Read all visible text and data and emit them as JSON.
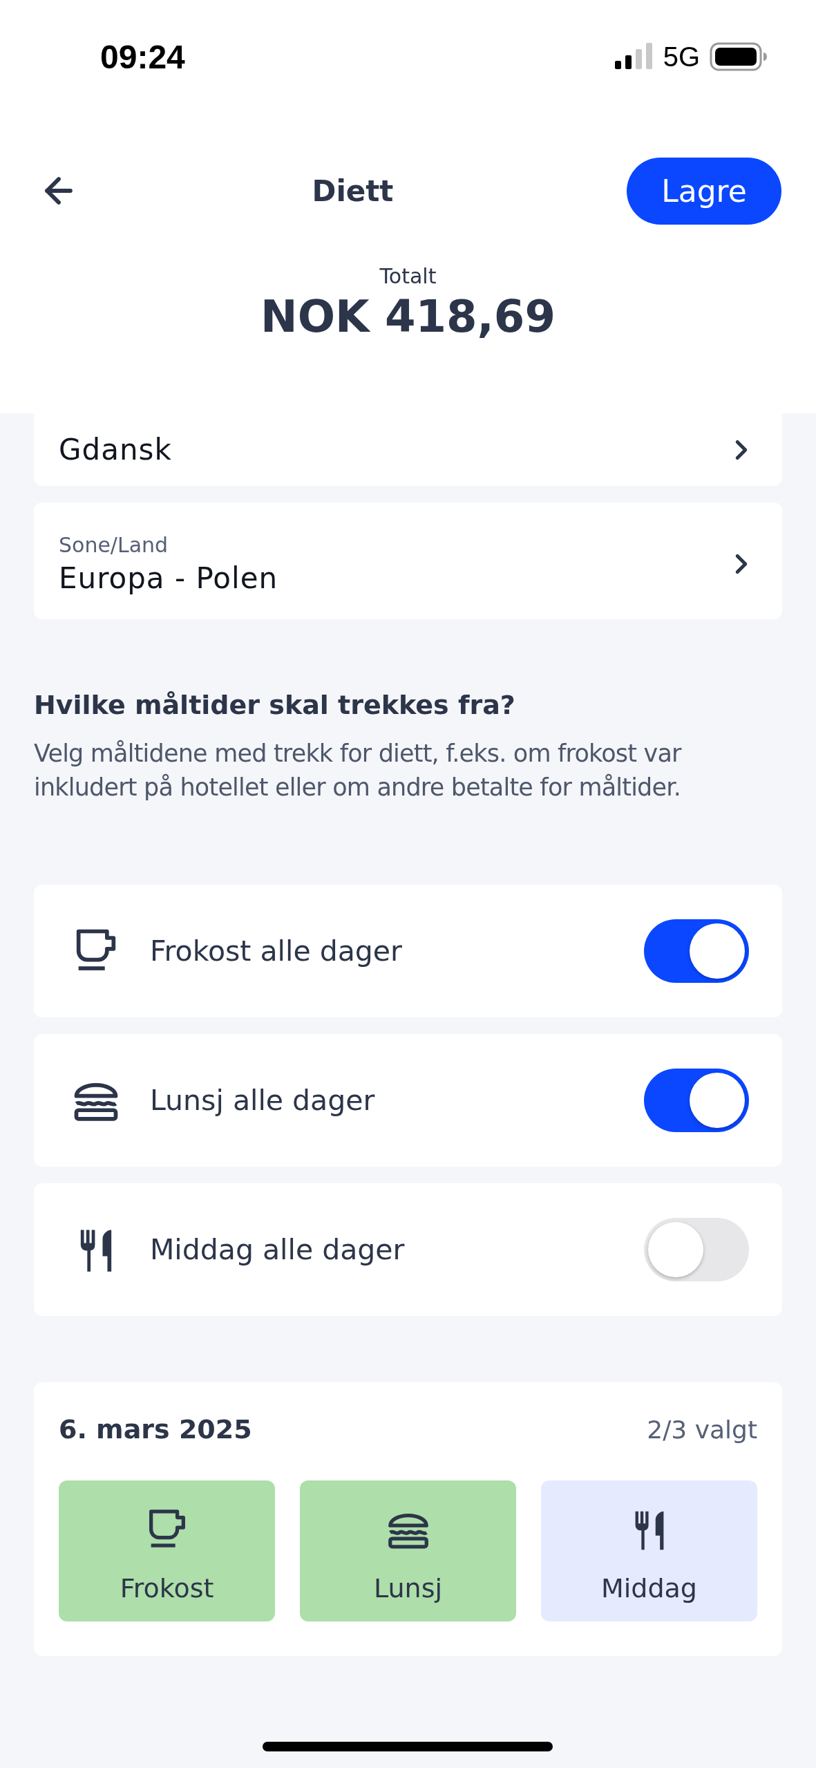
{
  "status_bar": {
    "time": "09:24",
    "network": "5G"
  },
  "header": {
    "title": "Diett",
    "save_button": "Lagre",
    "total_label": "Totalt",
    "total_amount": "NOK 418,69"
  },
  "fields": [
    {
      "value": "Gdansk"
    },
    {
      "label": "Sone/Land",
      "value": "Europa - Polen"
    }
  ],
  "meals_section": {
    "heading": "Hvilke måltider skal trekkes fra?",
    "description": "Velg måltidene med trekk for diett, f.eks. om frokost var inkludert på hotellet eller om andre betalte for måltider."
  },
  "meal_toggles": [
    {
      "kind": "breakfast",
      "label": "Frokost alle dager",
      "on": true
    },
    {
      "kind": "lunch",
      "label": "Lunsj alle dager",
      "on": true
    },
    {
      "kind": "dinner",
      "label": "Middag alle dager",
      "on": false
    }
  ],
  "days": [
    {
      "date": "6. mars 2025",
      "count": "2/3 valgt",
      "meals": [
        {
          "kind": "breakfast",
          "label": "Frokost",
          "selected": true
        },
        {
          "kind": "lunch",
          "label": "Lunsj",
          "selected": true
        },
        {
          "kind": "dinner",
          "label": "Middag",
          "selected": false
        }
      ]
    }
  ]
}
